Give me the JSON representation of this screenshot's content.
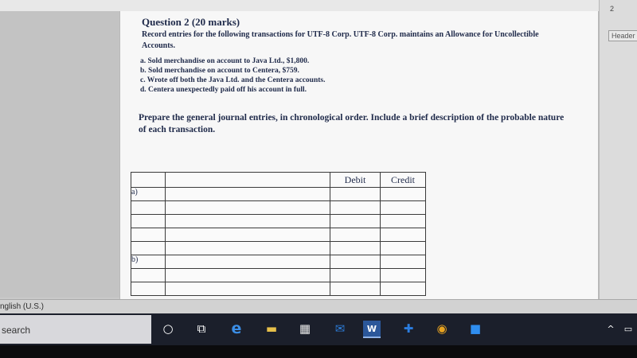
{
  "app": {
    "page_number": "2",
    "header_label": "Header",
    "language": "nglish (U.S.)"
  },
  "question": {
    "title": "Question 2 (20 marks)",
    "intro": "Record entries for the following transactions for UTF-8 Corp. UTF-8 Corp. maintains an Allowance for Uncollectible Accounts.",
    "items": [
      "a. Sold merchandise on account to Java Ltd., $1,800.",
      "b. Sold merchandise on account to Centera, $759.",
      "c. Wrote off both the Java Ltd. and the Centera accounts.",
      "d. Centera unexpectedly paid off his account in full."
    ],
    "instruction": "Prepare the general journal entries, in chronological order. Include a brief description of the probable nature of each transaction."
  },
  "journal": {
    "headers": [
      "",
      "",
      "Debit",
      "Credit"
    ],
    "row_labels": [
      "a)",
      "b)"
    ]
  },
  "taskbar": {
    "search_label": "search",
    "icons": [
      "cortana-icon",
      "task-view-icon",
      "edge-icon",
      "file-explorer-icon",
      "store-icon",
      "mail-icon",
      "word-icon",
      "shield-icon",
      "chrome-icon",
      "video-icon"
    ],
    "tray": "^ "
  },
  "colors": {
    "text": "#1f2a4a",
    "taskbar": "#1b1f2b",
    "edge": "#1e73d2",
    "word": "#2b579a",
    "chrome": "#e8a320"
  }
}
